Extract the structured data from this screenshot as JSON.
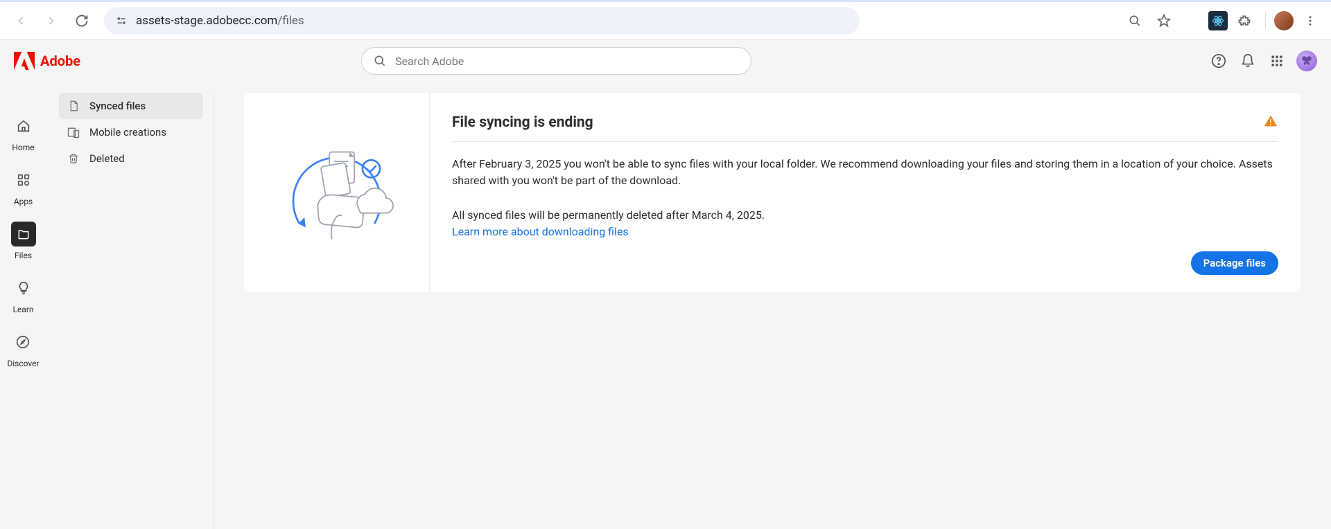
{
  "browser": {
    "url_host": "assets-stage.adobecc.com",
    "url_path": "/files"
  },
  "brand": "Adobe",
  "search_placeholder": "Search Adobe",
  "rail": [
    {
      "key": "home",
      "label": "Home"
    },
    {
      "key": "apps",
      "label": "Apps"
    },
    {
      "key": "files",
      "label": "Files"
    },
    {
      "key": "learn",
      "label": "Learn"
    },
    {
      "key": "discover",
      "label": "Discover"
    }
  ],
  "subnav": {
    "synced": "Synced files",
    "mobile": "Mobile creations",
    "deleted": "Deleted"
  },
  "banner": {
    "title": "File syncing is ending",
    "p1": "After February 3, 2025 you won't be able to sync files with your local folder. We recommend downloading your files and storing them in a location of your choice. Assets shared with you won't be part of the download.",
    "p2": "All synced files will be permanently deleted after March 4, 2025.",
    "learn": "Learn more about downloading files",
    "cta": "Package files"
  }
}
